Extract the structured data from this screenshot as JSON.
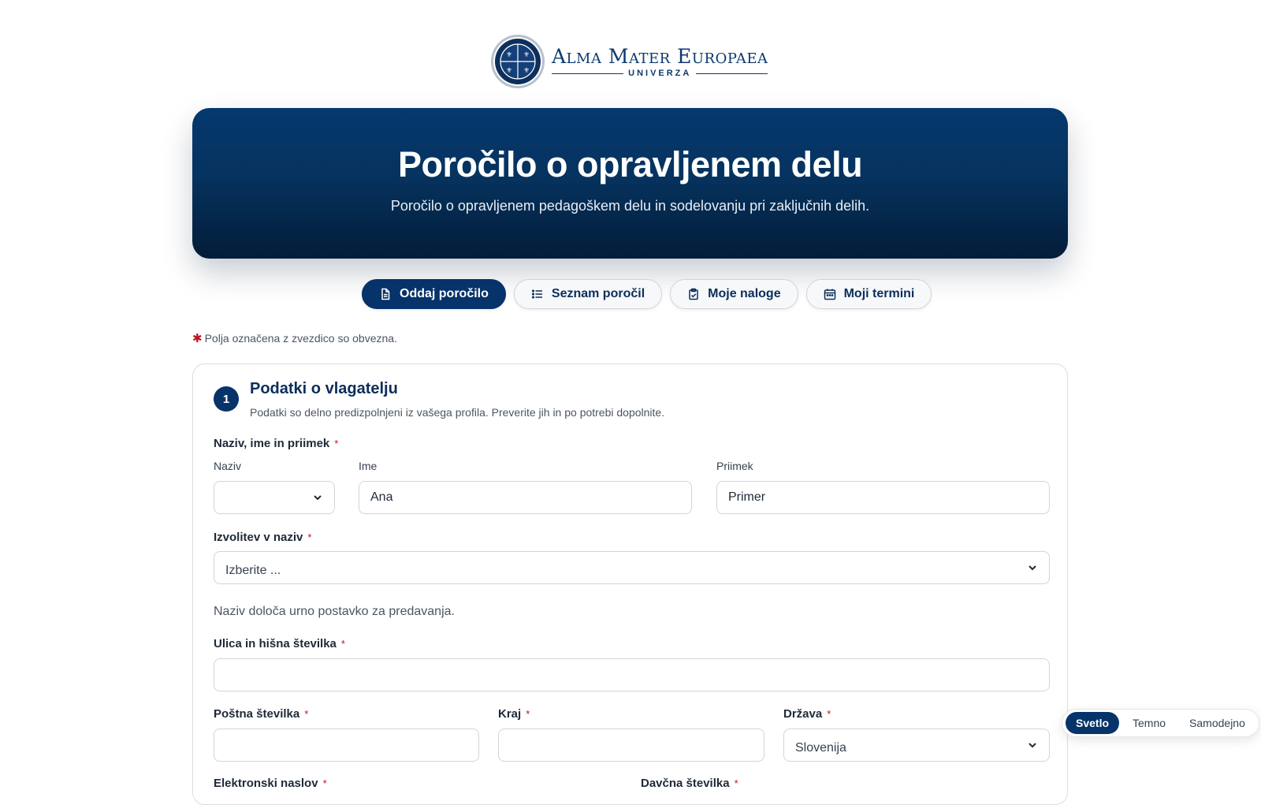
{
  "brand": {
    "name": "Alma Mater Europaea",
    "subtitle": "UNIVERZA"
  },
  "hero": {
    "title": "Poročilo o opravljenem delu",
    "subtitle": "Poročilo o opravljenem pedagoškem delu in sodelovanju pri zaključnih delih."
  },
  "tabs": [
    {
      "label": "Oddaj poročilo",
      "icon": "document-icon",
      "active": true
    },
    {
      "label": "Seznam poročil",
      "icon": "list-icon",
      "active": false
    },
    {
      "label": "Moje naloge",
      "icon": "clipboard-check-icon",
      "active": false
    },
    {
      "label": "Moji termini",
      "icon": "calendar-icon",
      "active": false
    }
  ],
  "required_note": {
    "star": "✱",
    "text": "Polja označena z zvezdico so obvezna."
  },
  "section": {
    "number": "1",
    "title": "Podatki o vlagatelju",
    "subtitle": "Podatki so delno predizpolnjeni iz vašega profila. Preverite jih in po potrebi dopolnite."
  },
  "form": {
    "required_mark": "*",
    "name_group": {
      "label": "Naziv, ime in priimek",
      "title_label": "Naziv",
      "title_value": "",
      "first_label": "Ime",
      "first_value": "Ana",
      "last_label": "Priimek",
      "last_value": "Primer"
    },
    "rank": {
      "label": "Izvolitev v naziv",
      "value": "Izberite ...",
      "hint": "Naziv določa urno postavko za predavanja."
    },
    "street": {
      "label": "Ulica in hišna številka",
      "value": ""
    },
    "postal": {
      "label": "Poštna številka",
      "value": ""
    },
    "city": {
      "label": "Kraj",
      "value": ""
    },
    "country": {
      "label": "Država",
      "value": "Slovenija"
    },
    "email": {
      "label": "Elektronski naslov"
    },
    "tax": {
      "label": "Davčna številka"
    }
  },
  "theme": {
    "options": [
      "Svetlo",
      "Temno",
      "Samodejno"
    ],
    "active": "Svetlo"
  },
  "colors": {
    "primary": "#06336a",
    "required": "#c1121f",
    "border": "#cfd5dc"
  }
}
